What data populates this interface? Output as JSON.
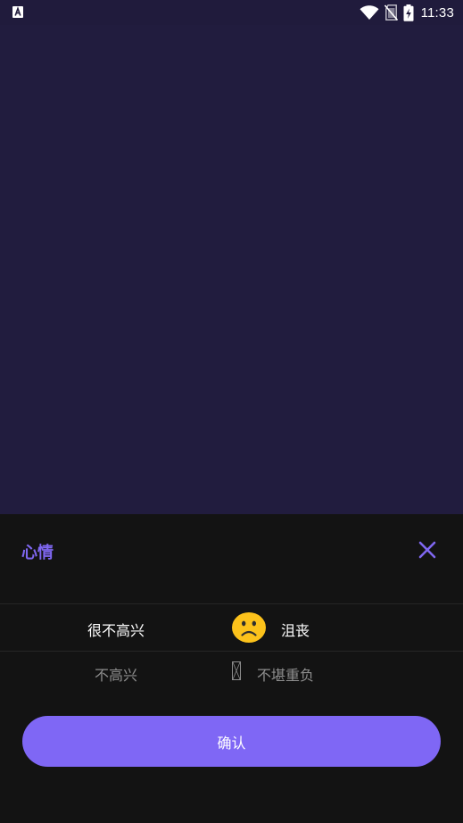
{
  "status_bar": {
    "time": "11:33",
    "icons": [
      "app-a-icon",
      "wifi-icon",
      "no-sim-icon",
      "battery-charging-icon"
    ]
  },
  "sheet": {
    "title": "心情",
    "close_icon": "close-icon",
    "options": [
      {
        "left": "很不高兴",
        "right": "沮丧",
        "icon": "frowning-face-emoji",
        "selected": true
      },
      {
        "left": "不高兴",
        "right": "不堪重负",
        "icon": "missing-glyph-icon",
        "selected": false
      }
    ],
    "confirm_label": "确认"
  },
  "colors": {
    "background": "#211c3e",
    "sheet": "#131313",
    "accent": "#7f67f1",
    "button": "#7f67f5",
    "selected_text": "#ffffff",
    "unselected_text": "#8e8e8e"
  }
}
